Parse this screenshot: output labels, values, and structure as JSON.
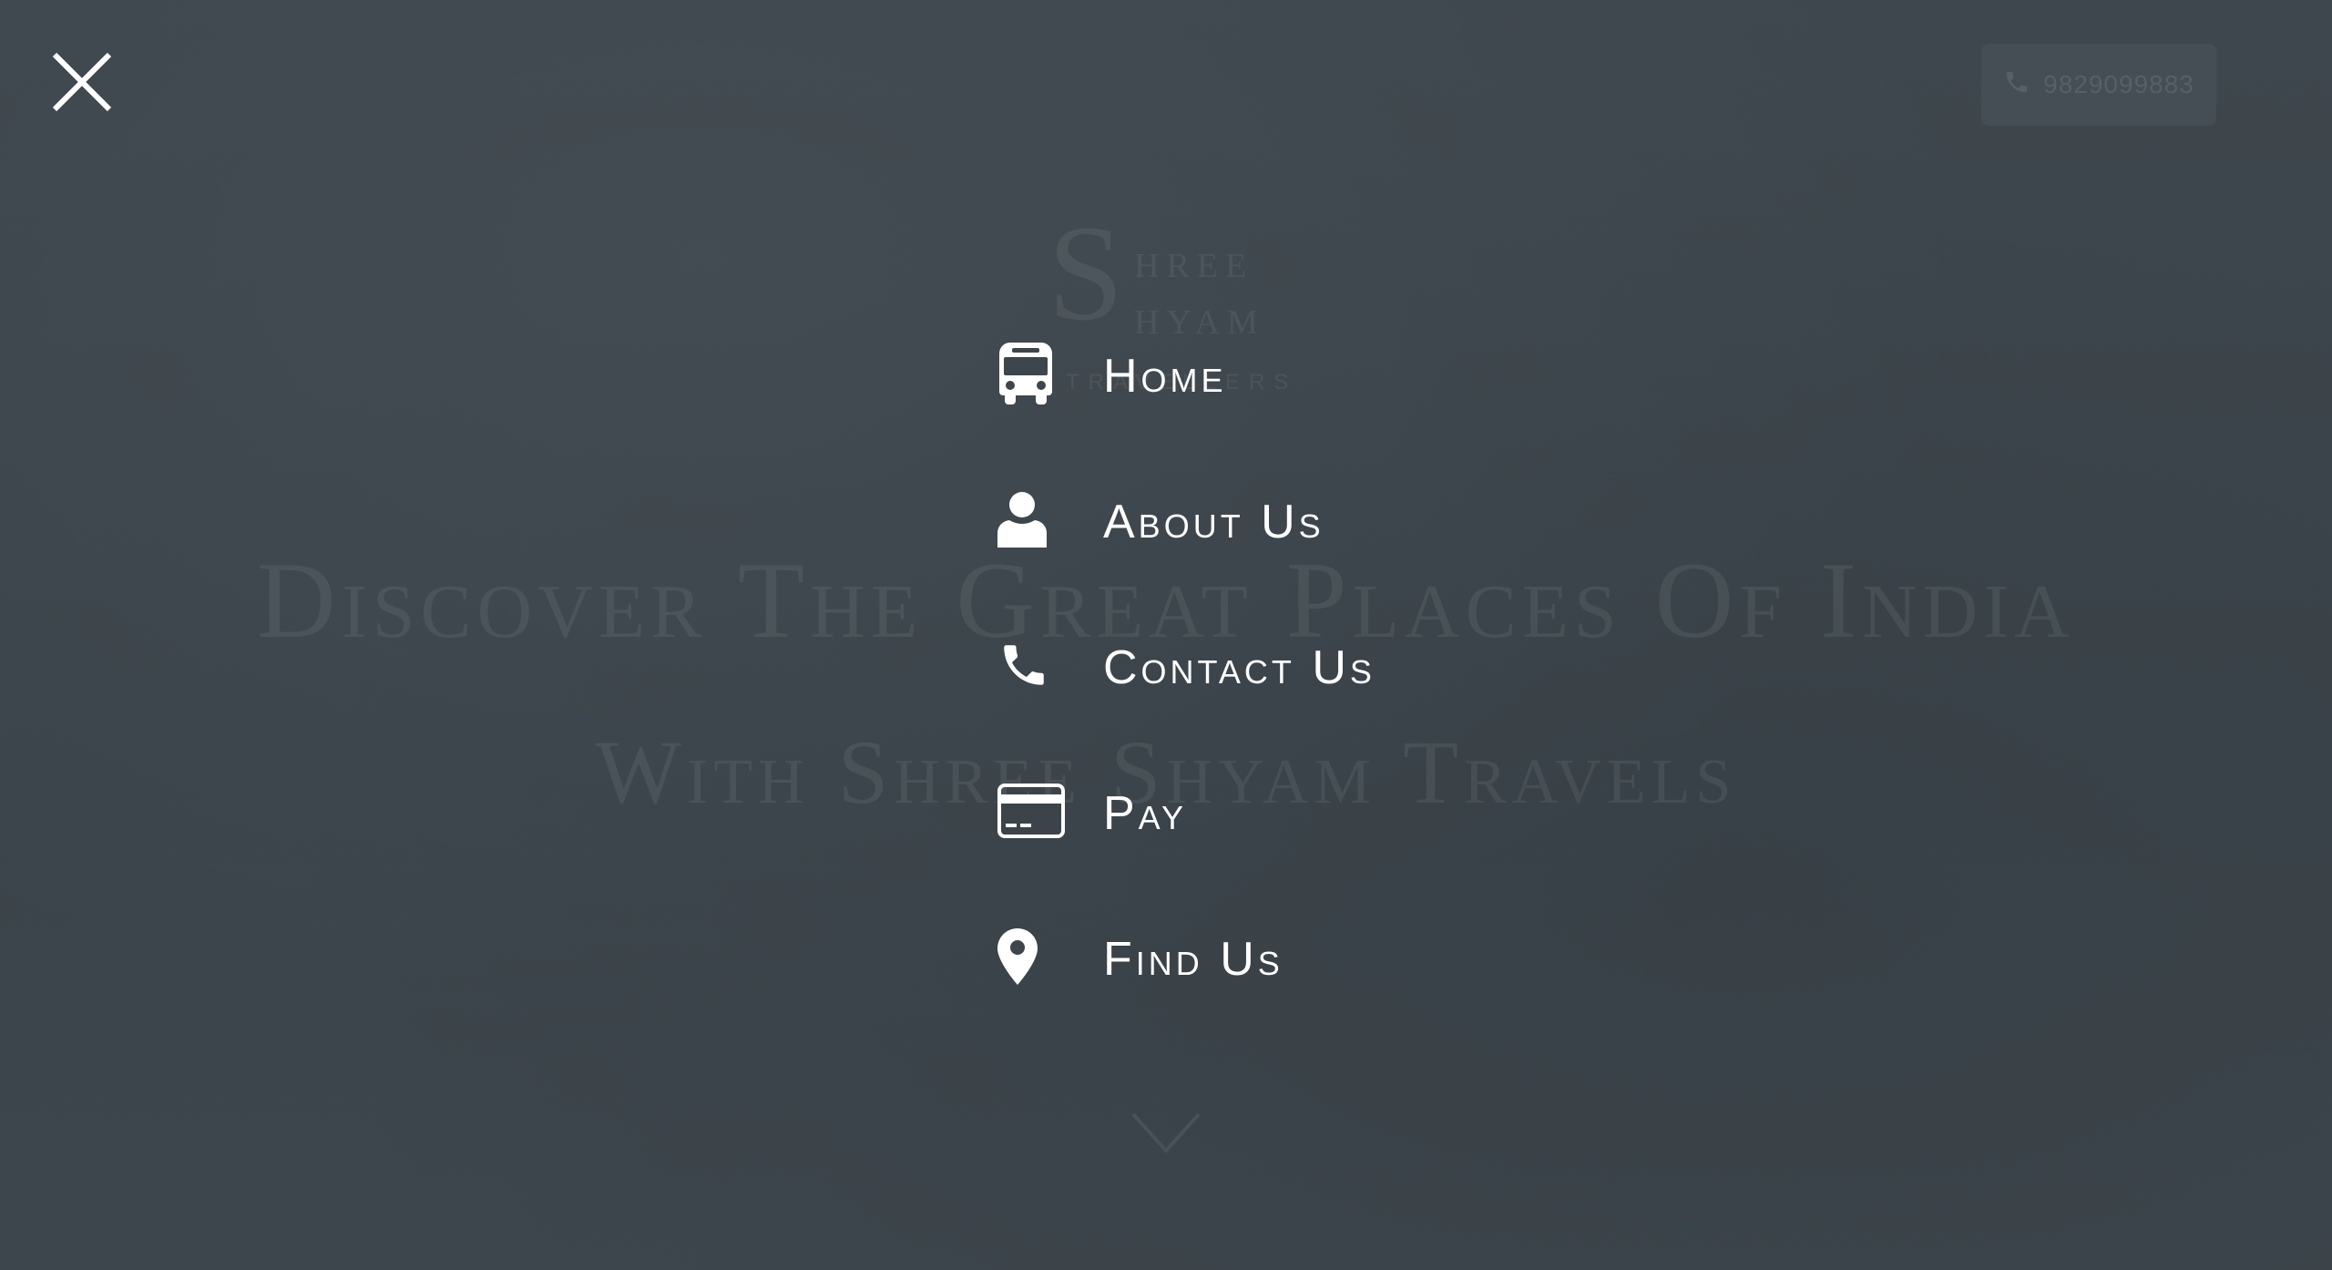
{
  "overlay": {
    "close_icon": "close-icon",
    "accent_color": "#ffffff",
    "overlay_color": "#3d464c"
  },
  "background": {
    "call_button": {
      "icon": "phone-icon",
      "label": "9829099883"
    },
    "logo": {
      "initial": "S",
      "line1": "hree",
      "line2": "hyam",
      "line3": "travellers"
    },
    "headline": {
      "line1": "Discover The Great Places Of India",
      "line2": "With Shree Shyam Travels"
    },
    "scroll_icon": "chevron-down-icon"
  },
  "menu": {
    "items": [
      {
        "label": "Home",
        "icon": "bus-icon"
      },
      {
        "label": "About Us",
        "icon": "user-icon"
      },
      {
        "label": "Contact Us",
        "icon": "phone-icon"
      },
      {
        "label": "Pay",
        "icon": "credit-card-icon"
      },
      {
        "label": "Find Us",
        "icon": "map-pin-icon"
      }
    ]
  }
}
